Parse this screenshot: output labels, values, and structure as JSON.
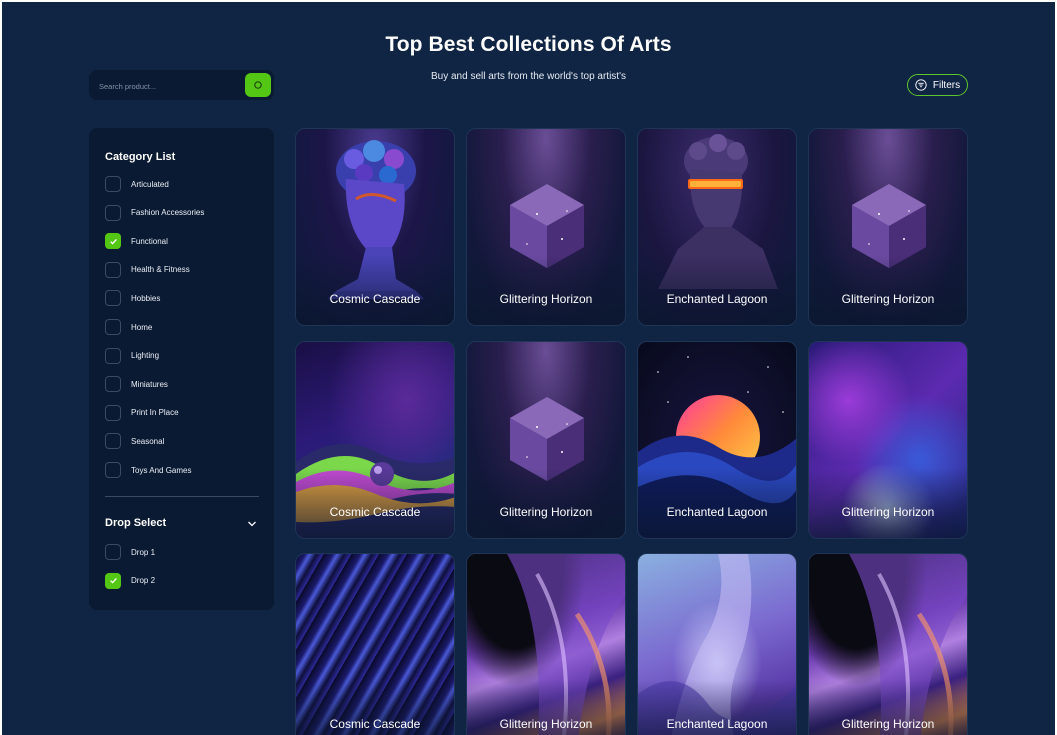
{
  "header": {
    "title": "Top Best Collections Of Arts",
    "subtitle": "Buy and sell arts from the world's top artist's"
  },
  "search": {
    "placeholder": "Search product..."
  },
  "filters": {
    "label": "Filters"
  },
  "sidebar": {
    "category_title": "Category List",
    "categories": [
      {
        "label": "Articulated",
        "checked": false
      },
      {
        "label": "Fashion Accessories",
        "checked": false
      },
      {
        "label": "Functional",
        "checked": true
      },
      {
        "label": "Health & Fitness",
        "checked": false
      },
      {
        "label": "Hobbies",
        "checked": false
      },
      {
        "label": "Home",
        "checked": false
      },
      {
        "label": "Lighting",
        "checked": false
      },
      {
        "label": "Miniatures",
        "checked": false
      },
      {
        "label": "Print In Place",
        "checked": false
      },
      {
        "label": "Seasonal",
        "checked": false
      },
      {
        "label": "Toys And Games",
        "checked": false
      }
    ],
    "drop_title": "Drop Select",
    "drops": [
      {
        "label": "Drop 1",
        "checked": false
      },
      {
        "label": "Drop 2",
        "checked": true
      }
    ]
  },
  "products": [
    {
      "title": "Cosmic Cascade",
      "art": "bust"
    },
    {
      "title": "Glittering Horizon",
      "art": "crystal"
    },
    {
      "title": "Enchanted Lagoon",
      "art": "visor"
    },
    {
      "title": "Glittering Horizon",
      "art": "crystal"
    },
    {
      "title": "Cosmic Cascade",
      "art": "fluid"
    },
    {
      "title": "Glittering Horizon",
      "art": "crystal"
    },
    {
      "title": "Enchanted Lagoon",
      "art": "sunset"
    },
    {
      "title": "Glittering Horizon",
      "art": "marble"
    },
    {
      "title": "Cosmic Cascade",
      "art": "swirl"
    },
    {
      "title": "Glittering Horizon",
      "art": "chrome"
    },
    {
      "title": "Enchanted Lagoon",
      "art": "glass"
    },
    {
      "title": "Glittering Horizon",
      "art": "chrome"
    }
  ],
  "colors": {
    "background": "#102443",
    "panel": "#0b1a33",
    "accent": "#54c614"
  }
}
